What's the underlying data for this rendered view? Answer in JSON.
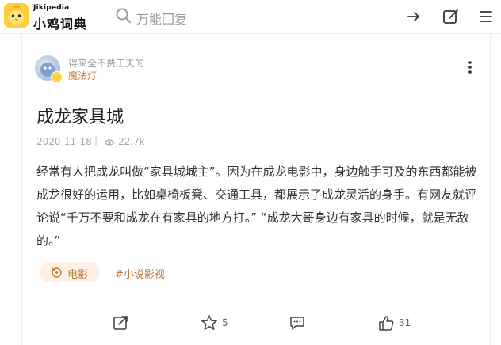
{
  "header": {
    "logo_sub": "Jikipedia",
    "logo_name": "小鸡词典",
    "search_placeholder": "万能回复"
  },
  "author": {
    "motto": "得来全不费工夫的",
    "name": "魔法灯"
  },
  "post": {
    "title": "成龙家具城",
    "date": "2020-11-18",
    "separator": "|",
    "views": "22.7k",
    "content": "经常有人把成龙叫做“家具城城主”。因为在成龙电影中，身边触手可及的东西都能被成龙很好的运用，比如桌椅板凳、交通工具，都展示了成龙灵活的身手。有网友就评论说“千万不要和成龙在有家具的地方打。” “成龙大哥身边有家具的时候，就是无敌的。”"
  },
  "tags": [
    {
      "label": "电影",
      "icon": "movie-reel-icon"
    },
    {
      "label": "#小说影视"
    }
  ],
  "actions": {
    "share": {
      "icon": "share-icon"
    },
    "favorite": {
      "icon": "star-icon",
      "count": "5"
    },
    "comment": {
      "icon": "comment-icon"
    },
    "like": {
      "icon": "thumbs-up-icon",
      "count": "31"
    }
  },
  "colors": {
    "accent": "#c47b2f",
    "tag_bg": "#fdf1e6",
    "logo_yellow": "#ffcd3c"
  }
}
